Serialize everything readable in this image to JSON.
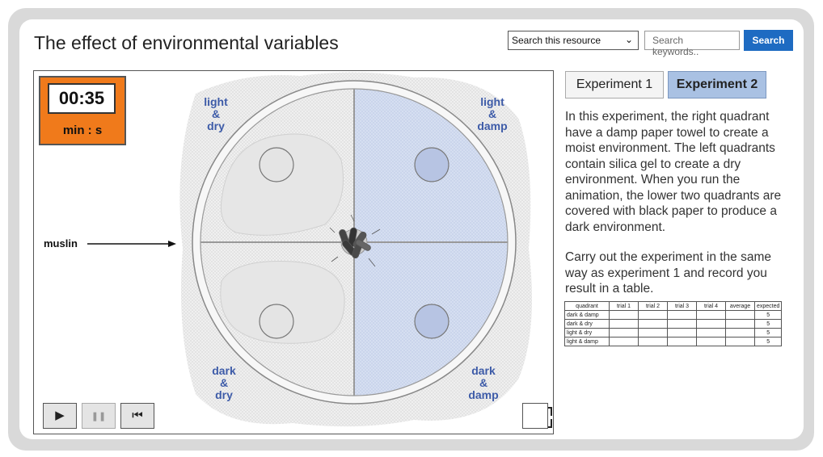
{
  "page": {
    "title": "The effect of environmental variables"
  },
  "search": {
    "scope_selected": "Search this resource",
    "placeholder": "Search keywords..",
    "button_label": "Search"
  },
  "simulation": {
    "timer": {
      "value": "00:35",
      "unit": "min : s"
    },
    "quadrants": {
      "top_left": [
        "light",
        "&",
        "dry"
      ],
      "top_right": [
        "light",
        "&",
        "damp"
      ],
      "bottom_left": [
        "dark",
        "&",
        "dry"
      ],
      "bottom_right": [
        "dark",
        "&",
        "damp"
      ]
    },
    "muslin_label": "muslin",
    "controls": {
      "play": "▶",
      "pause": "❚❚",
      "reset": "⏮"
    },
    "colors": {
      "damp": "#cfd9ef",
      "timer": "#f07a1b"
    }
  },
  "tabs": [
    {
      "label": "Experiment 1",
      "active": false
    },
    {
      "label": "Experiment 2",
      "active": true
    }
  ],
  "description": {
    "para1": "In this experiment, the right quadrant have a damp paper towel to create a moist environment. The left quadrants contain silica gel to create a dry environment. When you run the animation, the lower two quadrants are covered with black paper to produce a dark environment.",
    "para2": "Carry out the experiment in the same way as experiment 1 and record you result in a table."
  },
  "results_table": {
    "headers": [
      "quadrant",
      "trial 1",
      "trial 2",
      "trial 3",
      "trial 4",
      "average",
      "expected"
    ],
    "rows": [
      {
        "quadrant": "dark & damp",
        "expected": "5"
      },
      {
        "quadrant": "dark & dry",
        "expected": "5"
      },
      {
        "quadrant": "light & dry",
        "expected": "5"
      },
      {
        "quadrant": "light & damp",
        "expected": "5"
      }
    ]
  }
}
